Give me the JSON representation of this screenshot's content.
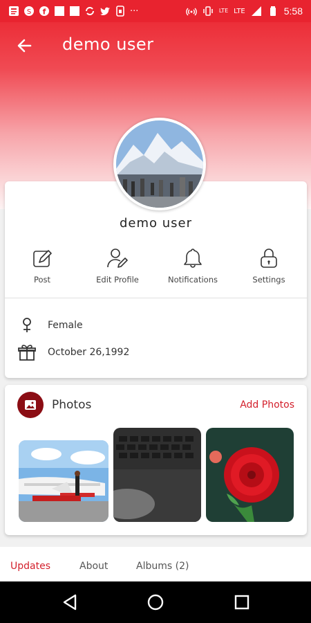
{
  "status_bar": {
    "time": "5:58",
    "left_icons": [
      "news-icon",
      "skype-icon",
      "facebook-icon",
      "square-icon",
      "square-icon",
      "sync-icon",
      "twitter-icon",
      "sim-icon",
      "more-icon"
    ],
    "right_icons": [
      "hotspot-icon",
      "vibrate-icon",
      "lte-icon",
      "signal-icon",
      "battery-icon"
    ],
    "lte_label_1": "LTE",
    "lte_label_2": "LTE"
  },
  "app_bar": {
    "title": "demo  user",
    "back_icon": "arrow-left-icon"
  },
  "profile": {
    "name": "demo  user",
    "actions": [
      {
        "label": "Post",
        "icon": "pencil-square-icon"
      },
      {
        "label": "Edit Profile",
        "icon": "user-edit-icon"
      },
      {
        "label": "Notifications",
        "icon": "bell-icon"
      },
      {
        "label": "Settings",
        "icon": "lock-icon"
      }
    ],
    "gender": "Female",
    "birthday": "October 26,1992"
  },
  "photos": {
    "title": "Photos",
    "add_label": "Add Photos",
    "items": [
      {
        "subject": "jet-and-woman-photo"
      },
      {
        "subject": "keyboard-photo"
      },
      {
        "subject": "red-dahlia-photo"
      }
    ]
  },
  "tabs": [
    {
      "label": "Updates",
      "active": true
    },
    {
      "label": "About",
      "active": false
    },
    {
      "label": "Albums (2)",
      "active": false
    }
  ],
  "colors": {
    "accent": "#d3202c",
    "status_bar": "#e8232f",
    "photos_icon_bg": "#8b0d14"
  }
}
